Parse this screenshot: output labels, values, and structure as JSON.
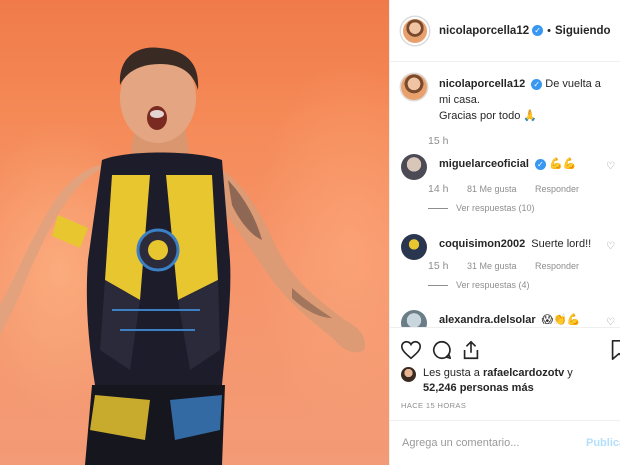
{
  "post": {
    "username": "nicolaporcella12",
    "following_label": "Siguiendo",
    "caption_line1": "De vuelta a mi casa.",
    "caption_line2": "Gracias por todo",
    "caption_emoji": "🙏",
    "caption_time": "15 h"
  },
  "comments": [
    {
      "username": "miguelarceoficial",
      "text": "💪💪",
      "verified": true,
      "time": "14 h",
      "likes": "81 Me gusta",
      "reply_label": "Responder",
      "replies": "Ver respuestas (10)"
    },
    {
      "username": "coquisimon2002",
      "text": "Suerte lord!!",
      "verified": false,
      "time": "15 h",
      "likes": "31 Me gusta",
      "reply_label": "Responder",
      "replies": "Ver respuestas (4)"
    },
    {
      "username": "alexandra.delsolar",
      "text": "😱👏💪",
      "verified": false
    }
  ],
  "footer": {
    "likes_prefix": "Les gusta a ",
    "likes_user": "rafaelcardozotv",
    "likes_suffix": " y",
    "likes_count": "52,246 personas más",
    "time_ago": "HACE 15 HORAS",
    "comment_placeholder": "Agrega un comentario...",
    "post_label": "Publicar"
  },
  "icons": {
    "verified": "verified-badge-icon",
    "like": "heart-icon",
    "comment": "comment-bubble-icon",
    "share": "share-arrow-icon",
    "save": "bookmark-icon",
    "comment_like": "small-heart-icon"
  },
  "colors": {
    "verified_blue": "#3897f0",
    "muted": "#8e8e8e",
    "post_disabled": "#b2dffc",
    "photo_background": "#f58a57"
  }
}
